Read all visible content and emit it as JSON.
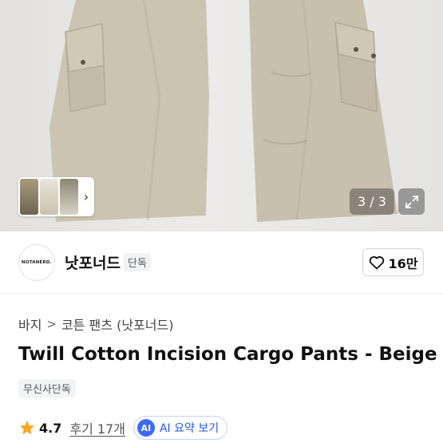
{
  "gallery": {
    "counter": "3 / 3",
    "thumbnail_chevron": "›",
    "expand_icon": "expand-arrows-icon"
  },
  "brand": {
    "logo_text": "NOTANERD.",
    "name": "낫포너드",
    "tag": "단독",
    "like_count": "16만"
  },
  "breadcrumb": {
    "category": "바지",
    "separator": ">",
    "subcategory": "코튼 팬츠 (낫포너드)"
  },
  "product": {
    "title": "Twill Cotton Incision Cargo Pants - Beige",
    "exclusive_badge": "무신사단독"
  },
  "rating": {
    "score": "4.7",
    "reviews_label": "후기 17개",
    "ai_icon": "AI",
    "ai_summary_label": "AI 요약 보기"
  },
  "colors": {
    "pants": "#cbc4b1",
    "accent_blue": "#3b6bff",
    "star": "#f5a623"
  }
}
